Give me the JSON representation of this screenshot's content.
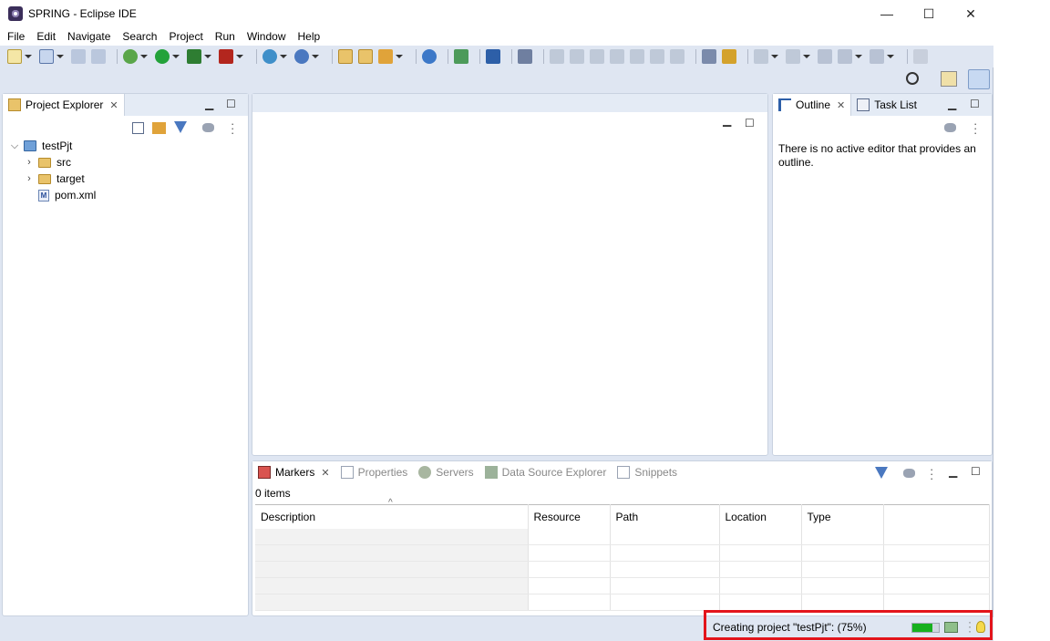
{
  "window": {
    "title": "SPRING - Eclipse IDE",
    "minimize": "—",
    "maximize": "☐",
    "close": "✕"
  },
  "menu": [
    "File",
    "Edit",
    "Navigate",
    "Search",
    "Project",
    "Run",
    "Window",
    "Help"
  ],
  "project_explorer": {
    "title": "Project Explorer",
    "tree": {
      "project": "testPjt",
      "children": [
        "src",
        "target",
        "pom.xml"
      ]
    },
    "file_badge": "M"
  },
  "outline": {
    "title": "Outline",
    "task_list_title": "Task List",
    "message": "There is no active editor that provides an outline."
  },
  "markers": {
    "tabs": [
      "Markers",
      "Properties",
      "Servers",
      "Data Source Explorer",
      "Snippets"
    ],
    "count": "0 items",
    "columns": [
      "Description",
      "Resource",
      "Path",
      "Location",
      "Type"
    ],
    "sort_indicator": "^"
  },
  "status": {
    "text": "Creating project \"testPjt\": (75%)",
    "progress": 0.75
  },
  "colors": {
    "accent_progress": "#16b01e",
    "highlight_border": "#e3141b",
    "chrome": "#dfe6f2"
  }
}
